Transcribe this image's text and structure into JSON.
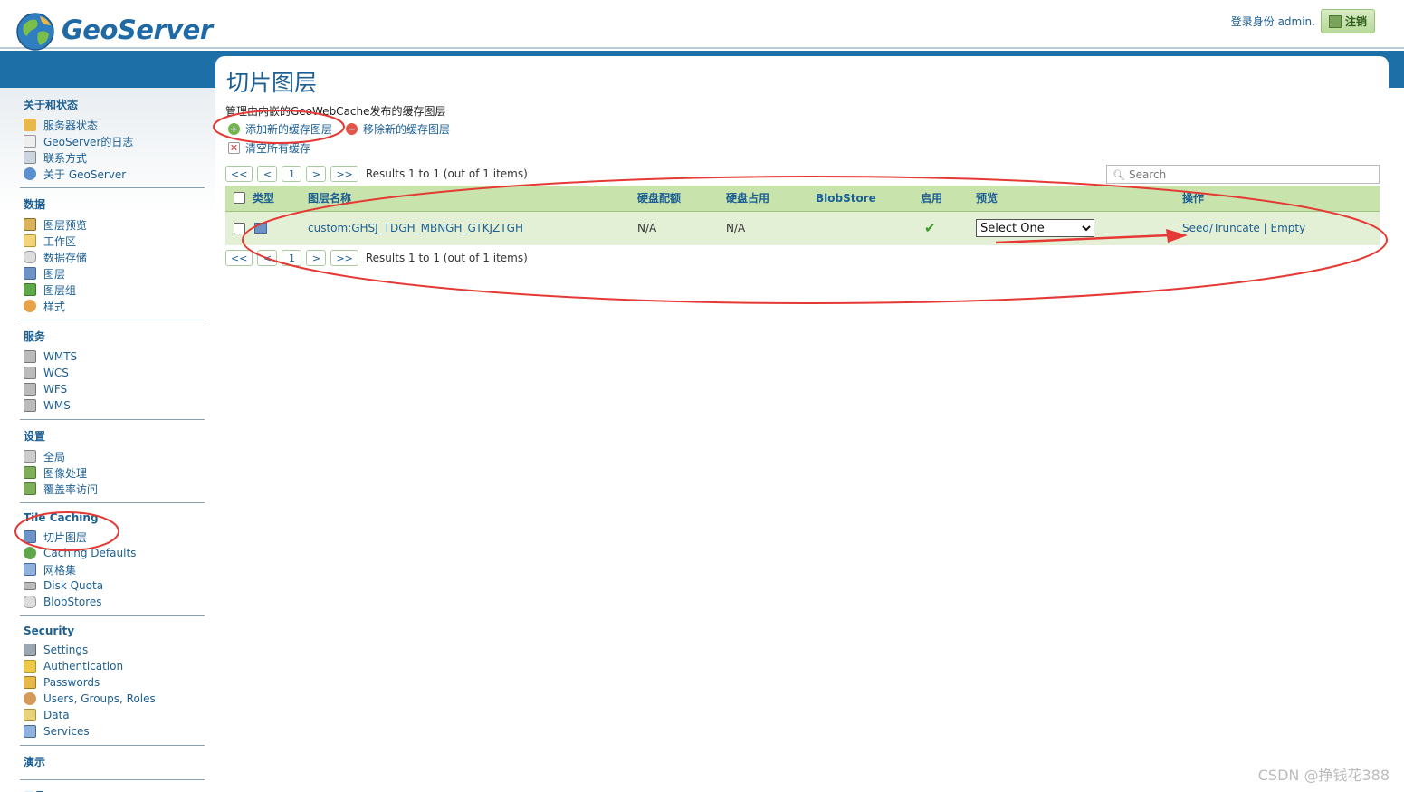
{
  "header": {
    "logo_text": "GeoServer",
    "login_text": "登录身份 admin.",
    "logout_label": "注销"
  },
  "sidebar": {
    "sections": [
      {
        "title": "关于和状态",
        "items": [
          {
            "label": "服务器状态",
            "icon": "server-status-icon"
          },
          {
            "label": "GeoServer的日志",
            "icon": "log-icon"
          },
          {
            "label": "联系方式",
            "icon": "contact-icon"
          },
          {
            "label": "关于 GeoServer",
            "icon": "about-icon"
          }
        ]
      },
      {
        "title": "数据",
        "items": [
          {
            "label": "图层预览",
            "icon": "layer-preview-icon"
          },
          {
            "label": "工作区",
            "icon": "workspace-icon"
          },
          {
            "label": "数据存储",
            "icon": "store-icon"
          },
          {
            "label": "图层",
            "icon": "layer-icon"
          },
          {
            "label": "图层组",
            "icon": "layer-group-icon"
          },
          {
            "label": "样式",
            "icon": "style-icon"
          }
        ]
      },
      {
        "title": "服务",
        "items": [
          {
            "label": "WMTS",
            "icon": "wmts-icon"
          },
          {
            "label": "WCS",
            "icon": "wcs-icon"
          },
          {
            "label": "WFS",
            "icon": "wfs-icon"
          },
          {
            "label": "WMS",
            "icon": "wms-icon"
          }
        ]
      },
      {
        "title": "设置",
        "items": [
          {
            "label": "全局",
            "icon": "global-icon"
          },
          {
            "label": "图像处理",
            "icon": "image-processing-icon"
          },
          {
            "label": "覆盖率访问",
            "icon": "coverage-access-icon"
          }
        ]
      },
      {
        "title": "Tile Caching",
        "items": [
          {
            "label": "切片图层",
            "icon": "tile-layers-icon"
          },
          {
            "label": "Caching Defaults",
            "icon": "caching-defaults-icon"
          },
          {
            "label": "网格集",
            "icon": "gridsets-icon"
          },
          {
            "label": "Disk Quota",
            "icon": "disk-quota-icon"
          },
          {
            "label": "BlobStores",
            "icon": "blobstores-icon"
          }
        ]
      },
      {
        "title": "Security",
        "items": [
          {
            "label": "Settings",
            "icon": "security-settings-icon"
          },
          {
            "label": "Authentication",
            "icon": "authentication-icon"
          },
          {
            "label": "Passwords",
            "icon": "passwords-icon"
          },
          {
            "label": "Users, Groups, Roles",
            "icon": "users-icon"
          },
          {
            "label": "Data",
            "icon": "data-security-icon"
          },
          {
            "label": "Services",
            "icon": "services-security-icon"
          }
        ]
      },
      {
        "title": "演示",
        "items": []
      },
      {
        "title": "工具",
        "items": []
      }
    ]
  },
  "main": {
    "title": "切片图层",
    "description": "管理由内嵌的GeoWebCache发布的缓存图层",
    "add_label": "添加新的缓存图层",
    "remove_label": "移除新的缓存图层",
    "clear_label": "清空所有缓存",
    "pager": {
      "first": "<<",
      "prev": "<",
      "page": "1",
      "next": ">",
      "last": ">>",
      "results": "Results 1 to 1 (out of 1 items)"
    },
    "search_placeholder": "Search",
    "table": {
      "headers": {
        "type": "类型",
        "name": "图层名称",
        "quota": "硬盘配额",
        "usage": "硬盘占用",
        "blobstore": "BlobStore",
        "enabled": "启用",
        "preview": "预览",
        "actions": "操作"
      },
      "rows": [
        {
          "name": "custom:GHSJ_TDGH_MBNGH_GTKJZTGH",
          "quota": "N/A",
          "usage": "N/A",
          "blobstore": "",
          "enabled": true,
          "preview": "Select One",
          "seed_label": "Seed/Truncate",
          "separator": "|",
          "empty_label": "Empty"
        }
      ]
    }
  },
  "colors": {
    "accent": "#1d5f92",
    "band": "#1d6fa8",
    "header_row": "#c9e3ad",
    "data_row": "#e4f0d6",
    "annotation": "#e53935"
  },
  "watermark": "CSDN @挣钱花388"
}
